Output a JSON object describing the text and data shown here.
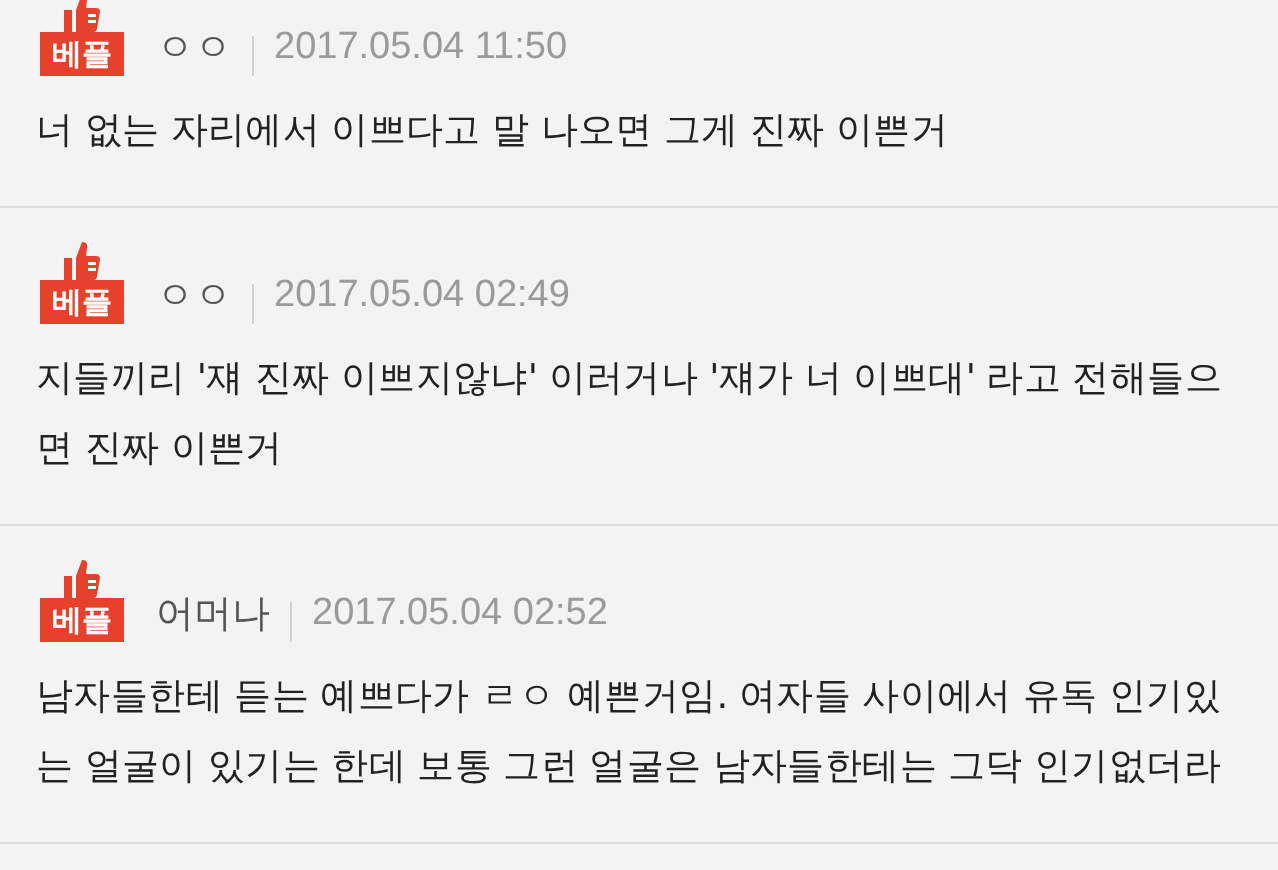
{
  "comments": [
    {
      "badge": "베플",
      "author": "ㅇㅇ",
      "date": "2017.05.04 11:50",
      "lines": [
        "너 없는 자리에서 이쁘다고 말 나오면 그게 진짜 이쁜거"
      ]
    },
    {
      "badge": "베플",
      "author": "ㅇㅇ",
      "date": "2017.05.04 02:49",
      "lines": [
        "지들끼리 '쟤 진짜 이쁘지않냐' 이러거나 '쟤가 너 이쁘대' 라고 전해들으",
        "면 진짜 이쁜거"
      ]
    },
    {
      "badge": "베플",
      "author": "어머나",
      "date": "2017.05.04 02:52",
      "lines": [
        "남자들한테 듣는 예쁘다가 ㄹㅇ 예쁜거임. 여자들 사이에서 유독 인기있",
        "는 얼굴이 있기는 한데 보통 그런 얼굴은 남자들한테는 그닥 인기없더라"
      ]
    }
  ]
}
